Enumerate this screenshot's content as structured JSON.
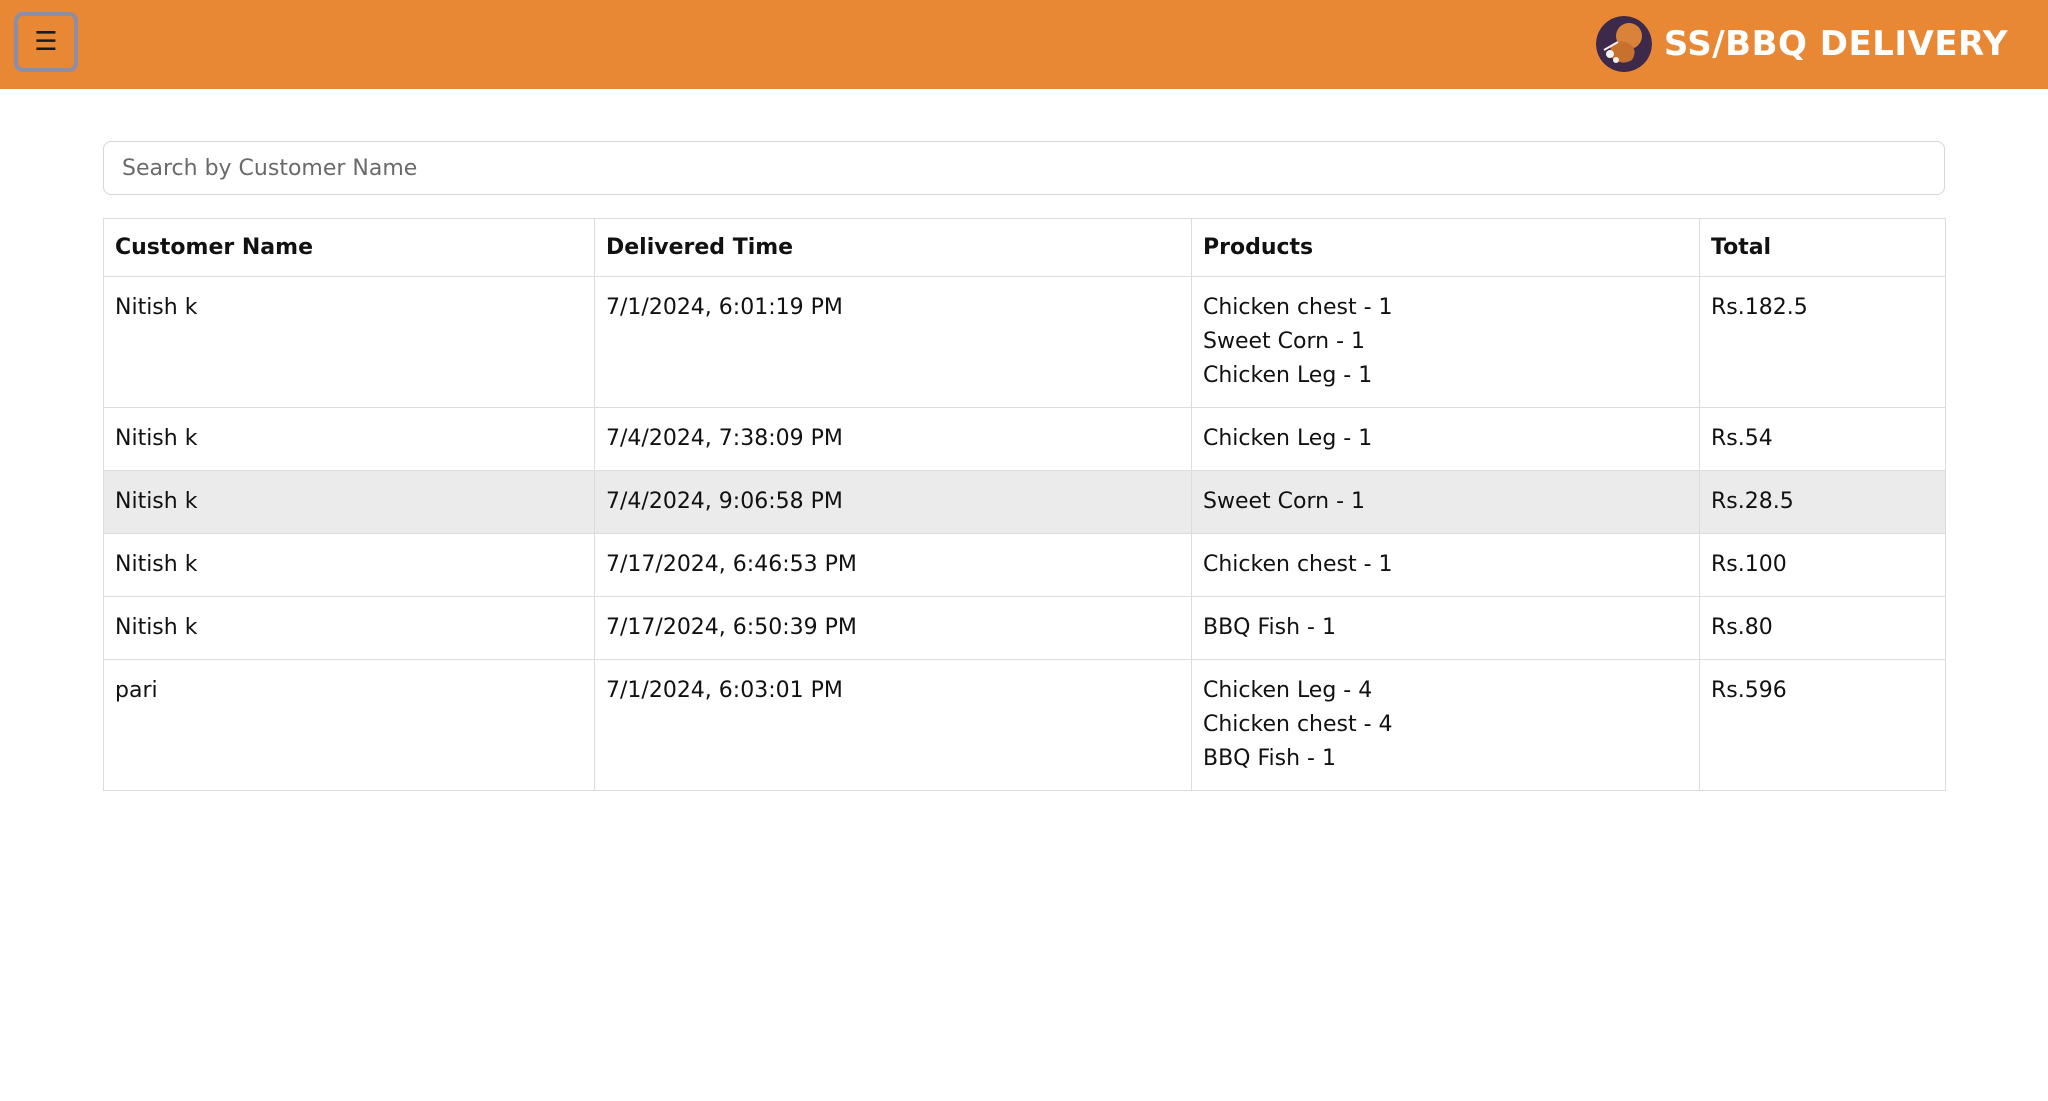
{
  "header": {
    "menu_icon": "☰",
    "brand_name": "SS/BBQ DELIVERY",
    "bg_color": "#e88834",
    "logo_icon": "bbq-logo-icon"
  },
  "search": {
    "placeholder": "Search by Customer Name",
    "value": ""
  },
  "table": {
    "columns": [
      "Customer Name",
      "Delivered Time",
      "Products",
      "Total"
    ],
    "rows": [
      {
        "customer": "Nitish k",
        "time": "7/1/2024, 6:01:19 PM",
        "products": [
          "Chicken chest - 1",
          "Sweet Corn - 1",
          "Chicken Leg - 1"
        ],
        "total": "Rs.182.5"
      },
      {
        "customer": "Nitish k",
        "time": "7/4/2024, 7:38:09 PM",
        "products": [
          "Chicken Leg - 1"
        ],
        "total": "Rs.54"
      },
      {
        "customer": "Nitish k",
        "time": "7/4/2024, 9:06:58 PM",
        "products": [
          "Sweet Corn - 1"
        ],
        "total": "Rs.28.5"
      },
      {
        "customer": "Nitish k",
        "time": "7/17/2024, 6:46:53 PM",
        "products": [
          "Chicken chest - 1"
        ],
        "total": "Rs.100"
      },
      {
        "customer": "Nitish k",
        "time": "7/17/2024, 6:50:39 PM",
        "products": [
          "BBQ Fish - 1"
        ],
        "total": "Rs.80"
      },
      {
        "customer": "pari",
        "time": "7/1/2024, 6:03:01 PM",
        "products": [
          "Chicken Leg - 4",
          "Chicken chest - 4",
          "BBQ Fish - 1"
        ],
        "total": "Rs.596"
      }
    ],
    "highlighted_row": 2
  }
}
